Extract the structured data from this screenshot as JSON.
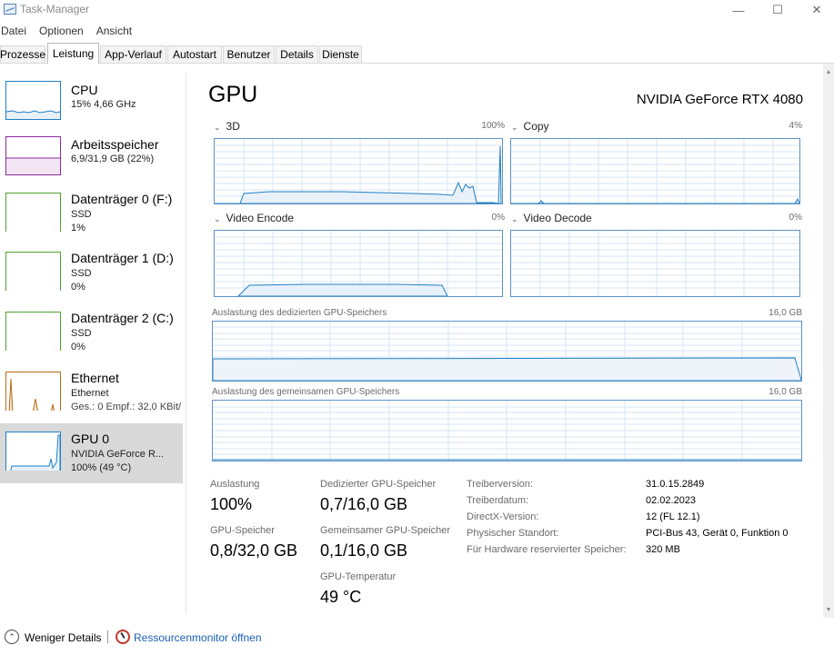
{
  "window": {
    "title": "Task-Manager"
  },
  "menu": [
    "Datei",
    "Optionen",
    "Ansicht"
  ],
  "tabs": [
    "Prozesse",
    "Leistung",
    "App-Verlauf",
    "Autostart",
    "Benutzer",
    "Details",
    "Dienste"
  ],
  "active_tab": "Leistung",
  "sidebar": {
    "items": [
      {
        "title": "CPU",
        "sub1": "15%  4,66 GHz",
        "sub2": "",
        "color": "#1f7fc5"
      },
      {
        "title": "Arbeitsspeicher",
        "sub1": "6,9/31,9 GB (22%)",
        "sub2": "",
        "color": "#8b2a9e"
      },
      {
        "title": "Datenträger 0 (F:)",
        "sub1": "SSD",
        "sub2": "1%",
        "color": "#4da62f"
      },
      {
        "title": "Datenträger 1 (D:)",
        "sub1": "SSD",
        "sub2": "0%",
        "color": "#4da62f"
      },
      {
        "title": "Datenträger 2 (C:)",
        "sub1": "SSD",
        "sub2": "0%",
        "color": "#4da62f"
      },
      {
        "title": "Ethernet",
        "sub1": "Ethernet",
        "sub2": "Ges.: 0 Empf.: 32,0 KBit/",
        "color": "#b86a12"
      },
      {
        "title": "GPU 0",
        "sub1": "NVIDIA GeForce R...",
        "sub2": "100%  (49 °C)",
        "color": "#1f7fc5"
      }
    ]
  },
  "main": {
    "title": "GPU",
    "device": "NVIDIA GeForce RTX 4080",
    "engines": [
      {
        "name": "3D",
        "pct": "100%"
      },
      {
        "name": "Copy",
        "pct": "4%"
      },
      {
        "name": "Video Encode",
        "pct": "0%"
      },
      {
        "name": "Video Decode",
        "pct": "0%"
      }
    ],
    "dedicated_label": "Auslastung des dedizierten GPU-Speichers",
    "dedicated_max": "16,0 GB",
    "shared_label": "Auslastung des gemeinsamen GPU-Speichers",
    "shared_max": "16,0 GB"
  },
  "stats": {
    "auslastung_label": "Auslastung",
    "auslastung_value": "100%",
    "gpu_speicher_label": "GPU-Speicher",
    "gpu_speicher_value": "0,8/32,0 GB",
    "dediziert_label": "Dedizierter GPU-Speicher",
    "dediziert_value": "0,7/16,0 GB",
    "gemeinsam_label": "Gemeinsamer GPU-Speicher",
    "gemeinsam_value": "0,1/16,0 GB",
    "temp_label": "GPU-Temperatur",
    "temp_value": "49 °C"
  },
  "info": [
    {
      "key": "Treiberversion:",
      "value": "31.0.15.2849"
    },
    {
      "key": "Treiberdatum:",
      "value": "02.02.2023"
    },
    {
      "key": "DirectX-Version:",
      "value": "12 (FL 12.1)"
    },
    {
      "key": "Physischer Standort:",
      "value": "PCI-Bus 43, Gerät 0, Funktion 0"
    },
    {
      "key": "Für Hardware reservierter Speicher:",
      "value": "320 MB"
    }
  ],
  "footer": {
    "fewer_details": "Weniger Details",
    "resmon_link": "Ressourcenmonitor öffnen"
  },
  "colors": {
    "gpu_line": "#1f7fc5",
    "gpu_fill": "#f1f6fb",
    "grid": "#d6e6f4"
  }
}
